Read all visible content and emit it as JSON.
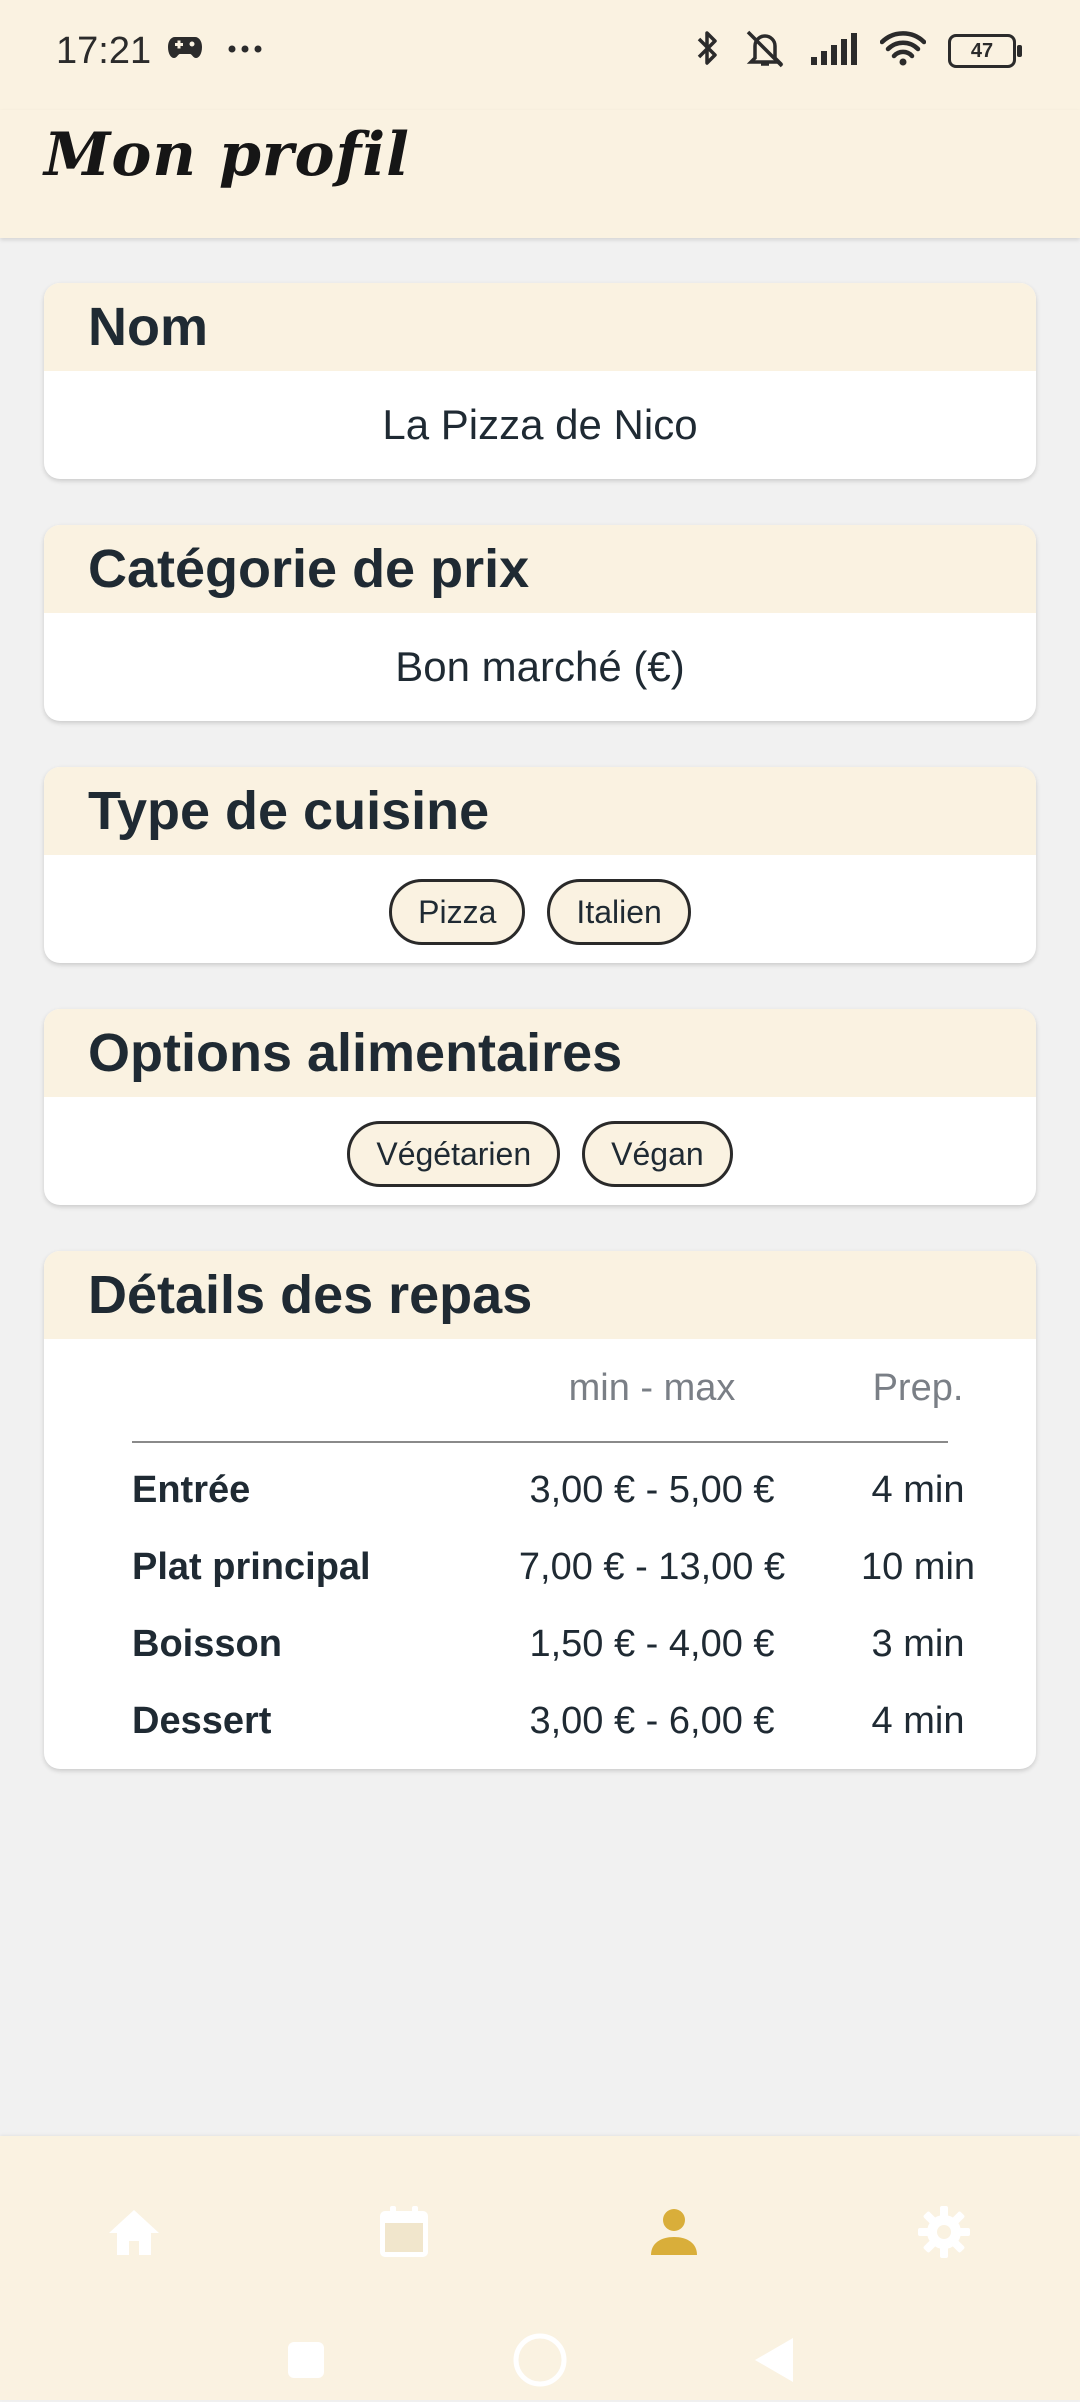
{
  "status_bar": {
    "time": "17:21",
    "battery": "47",
    "icons": [
      "game-controller-icon",
      "more-dots-icon",
      "bluetooth-icon",
      "bell-mute-icon",
      "signal-icon",
      "wifi-icon",
      "battery-icon"
    ]
  },
  "app_bar": {
    "title": "Mon profil"
  },
  "name_card": {
    "title": "Nom",
    "value": "La Pizza de Nico"
  },
  "price_card": {
    "title": "Catégorie de prix",
    "value": "Bon marché (€)"
  },
  "cuisine_card": {
    "title": "Type de cuisine",
    "chips": [
      "Pizza",
      "Italien"
    ]
  },
  "diet_card": {
    "title": "Options alimentaires",
    "chips": [
      "Végétarien",
      "Végan"
    ]
  },
  "meals_card": {
    "title": "Détails des repas",
    "columns": {
      "price": "min - max",
      "prep": "Prep."
    },
    "rows": [
      {
        "label": "Entrée",
        "price": "3,00 € - 5,00 €",
        "prep": "4 min"
      },
      {
        "label": "Plat principal",
        "price": "7,00 € - 13,00 €",
        "prep": "10 min"
      },
      {
        "label": "Boisson",
        "price": "1,50 € - 4,00 €",
        "prep": "3 min"
      },
      {
        "label": "Dessert",
        "price": "3,00 € - 6,00 €",
        "prep": "4 min"
      }
    ]
  },
  "bottom_nav": {
    "items": [
      {
        "icon": "home-icon",
        "active": false
      },
      {
        "icon": "calendar-icon",
        "active": false
      },
      {
        "icon": "person-icon",
        "active": true
      },
      {
        "icon": "gear-icon",
        "active": false
      }
    ],
    "active_color": "#D9AE3A",
    "inactive_color": "#FFFFFF"
  },
  "system_nav": {
    "icons": [
      "recents-square-icon",
      "home-circle-icon",
      "back-triangle-icon"
    ]
  }
}
